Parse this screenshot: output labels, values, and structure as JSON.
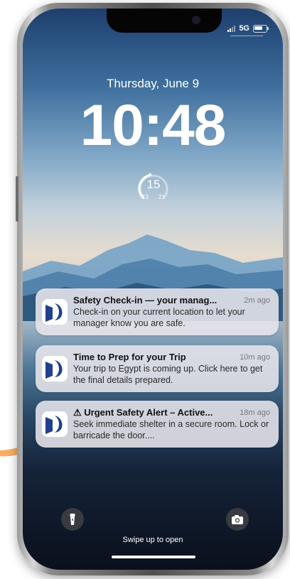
{
  "status_bar": {
    "network": "5G",
    "signal_icon": "signal-bars-icon",
    "battery_icon": "battery-icon"
  },
  "lock_screen": {
    "date": "Thursday, June 9",
    "time": "10:48"
  },
  "weather_widget": {
    "current": "15",
    "low": "13",
    "high": "21"
  },
  "notifications": [
    {
      "title": "Safety Check-in — your manag...",
      "time": "2m ago",
      "body": "Check-in on your current location to let your manager know you are safe."
    },
    {
      "title": "Time to Prep for your Trip",
      "time": "10m ago",
      "body": "Your trip to Egypt is coming up. Click here to get the final details prepared."
    },
    {
      "title": "⚠ Urgent Safety Alert – Active...",
      "time": "18m ago",
      "body": "Seek immediate shelter in a secure room. Lock or barricade the door...."
    }
  ],
  "bottom": {
    "swipe_hint": "Swipe up to open",
    "flashlight_icon": "flashlight-icon",
    "camera_icon": "camera-icon"
  },
  "colors": {
    "app_icon_primary": "#1f3f8f",
    "app_icon_bg": "#ffffff",
    "accent_swoosh": "#f6a14a"
  }
}
